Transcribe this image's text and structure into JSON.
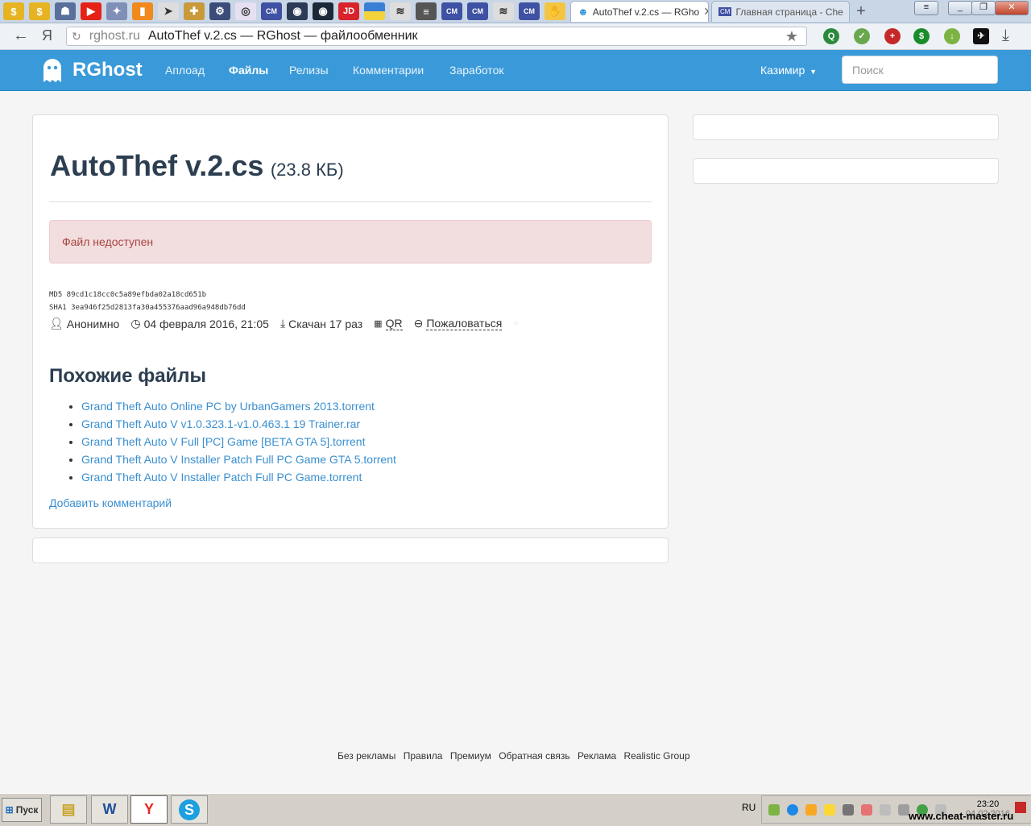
{
  "browser": {
    "tabs": [
      {
        "label": "AutoThef v.2.cs — RGho",
        "active": true
      },
      {
        "label": "Главная страница - Che",
        "active": false
      }
    ],
    "pinned_icons": [
      "coin-icon",
      "coin-icon",
      "robot-icon",
      "youtube-icon",
      "gamepad-icon",
      "chart-icon",
      "cursor-icon",
      "gear-plus-icon",
      "gear-icon",
      "compass-icon",
      "cm-icon",
      "steam-icon",
      "steam-icon",
      "jd-icon",
      "ukraine-flag-icon",
      "books-icon",
      "database-icon",
      "cm-icon",
      "cm-icon",
      "books-icon",
      "cm-icon",
      "hand-icon"
    ],
    "pinned_labels": {
      "cm": "CM",
      "jd": "JD"
    },
    "address": {
      "domain": "rghost.ru",
      "title": "AutoThef v.2.cs — RGhost — файлообменник"
    },
    "yandex_letter": "Я"
  },
  "site": {
    "brand": "RGhost",
    "nav": [
      "Аплоад",
      "Файлы",
      "Релизы",
      "Комментарии",
      "Заработок"
    ],
    "user": "Казимир",
    "search_placeholder": "Поиск"
  },
  "file": {
    "name": "AutoThef v.2.cs",
    "size": "(23.8 КБ)",
    "alert": "Файл недоступен",
    "md5": "MD5   89cd1c18cc0c5a89efbda02a18cd651b",
    "sha1": "SHA1 3ea946f25d2813fa30a455376aad96a948db76dd",
    "author": "Анонимно",
    "date": "04 февраля 2016, 21:05",
    "downloads": "Скачан 17 раз",
    "qr": "QR",
    "report": "Пожаловаться"
  },
  "similar": {
    "title": "Похожие файлы",
    "items": [
      "Grand Theft Auto Online PC by UrbanGamers 2013.torrent",
      "Grand Theft Auto V v1.0.323.1-v1.0.463.1 19 Trainer.rar",
      "Grand Theft Auto V Full [PC] Game [BETA GTA 5].torrent",
      "Grand Theft Auto V Installer Patch Full PC Game GTA 5.torrent",
      "Grand Theft Auto V Installer Patch Full PC Game.torrent"
    ],
    "add_comment": "Добавить комментарий"
  },
  "footer": [
    "Без рекламы",
    "Правила",
    "Премиум",
    "Обратная связь",
    "Реклама",
    "Realistic Group"
  ],
  "taskbar": {
    "start": "Пуск",
    "apps": [
      "explorer",
      "word",
      "yandex",
      "skype"
    ],
    "app_letters": [
      "W",
      "Y",
      "S"
    ],
    "lang": "RU",
    "time": "23:20",
    "date": "04.02.2016"
  },
  "watermark": "www.cheat-master.ru",
  "colors": {
    "nav_bg": "#3a9ad9",
    "link": "#3a8fd0",
    "alert_bg": "#f2dede",
    "alert_text": "#a94442"
  }
}
